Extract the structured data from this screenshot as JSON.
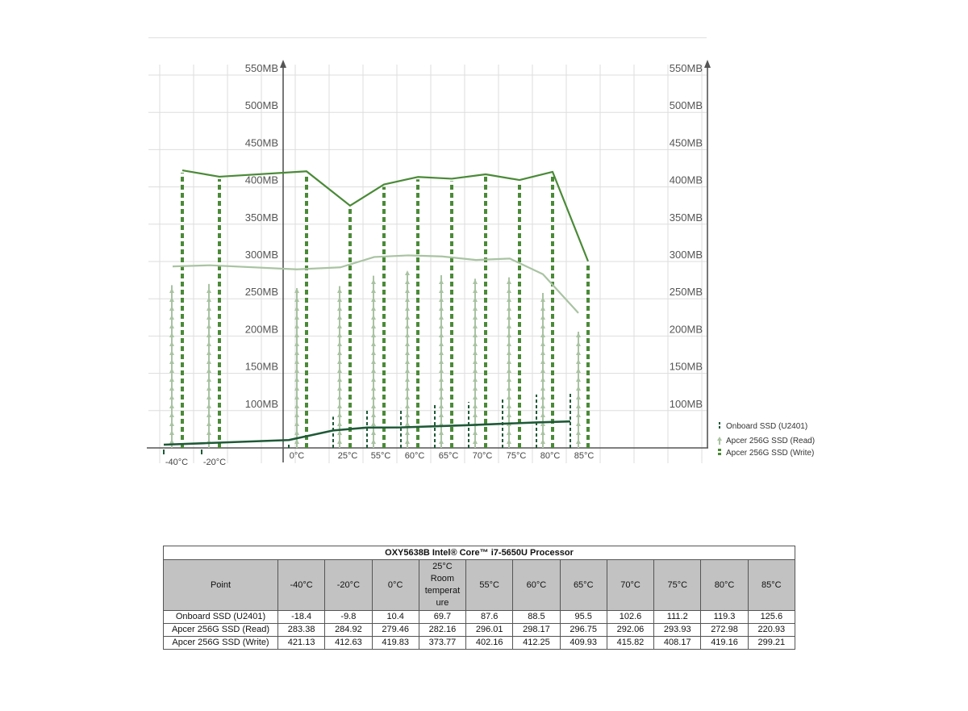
{
  "chart_data": {
    "type": "line",
    "categories": [
      "-40°C",
      "-20°C",
      "0°C",
      "25°C",
      "55°C",
      "60°C",
      "65°C",
      "70°C",
      "75°C",
      "80°C",
      "85°C"
    ],
    "y_tick_labels": [
      "100MB",
      "150MB",
      "200MB",
      "250MB",
      "300MB",
      "350MB",
      "400MB",
      "450MB",
      "500MB",
      "550MB"
    ],
    "y_ticks": [
      100,
      150,
      200,
      250,
      300,
      350,
      400,
      450,
      500,
      550
    ],
    "ylim": [
      50,
      600
    ],
    "grid": true,
    "legend_position": "right",
    "series": [
      {
        "name": "Onboard SSD (U2401)",
        "values": [
          -18.4,
          -9.8,
          10.4,
          69.7,
          87.6,
          88.5,
          95.5,
          102.6,
          111.2,
          119.3,
          125.6
        ]
      },
      {
        "name": "Apcer 256G SSD (Read)",
        "values": [
          283.38,
          284.92,
          279.46,
          282.16,
          296.01,
          298.17,
          296.75,
          292.06,
          293.93,
          272.98,
          220.93
        ]
      },
      {
        "name": "Apcer 256G SSD (Write)",
        "values": [
          421.13,
          412.63,
          419.83,
          373.77,
          402.16,
          412.25,
          409.93,
          415.82,
          408.17,
          419.16,
          299.21
        ]
      }
    ]
  },
  "colors": {
    "onboard": "#1e5a37",
    "read": "#a9c3a2",
    "write": "#4a8a37",
    "grid": "#dddddd",
    "axis": "#555555"
  },
  "table": {
    "title": "OXY5638B Intel® Core™ i7-5650U Processor",
    "point_label": "Point",
    "headers": [
      "-40°C",
      "-20°C",
      "0°C",
      "25°C Room temperat ure",
      "55°C",
      "60°C",
      "65°C",
      "70°C",
      "75°C",
      "80°C",
      "85°C"
    ],
    "rows": [
      {
        "label": "Onboard SSD (U2401)",
        "values": [
          "-18.4",
          "-9.8",
          "10.4",
          "69.7",
          "87.6",
          "88.5",
          "95.5",
          "102.6",
          "111.2",
          "119.3",
          "125.6"
        ]
      },
      {
        "label": "Apcer 256G SSD (Read)",
        "values": [
          "283.38",
          "284.92",
          "279.46",
          "282.16",
          "296.01",
          "298.17",
          "296.75",
          "292.06",
          "293.93",
          "272.98",
          "220.93"
        ]
      },
      {
        "label": "Apcer 256G SSD (Write)",
        "values": [
          "421.13",
          "412.63",
          "419.83",
          "373.77",
          "402.16",
          "412.25",
          "409.93",
          "415.82",
          "408.17",
          "419.16",
          "299.21"
        ]
      }
    ]
  }
}
